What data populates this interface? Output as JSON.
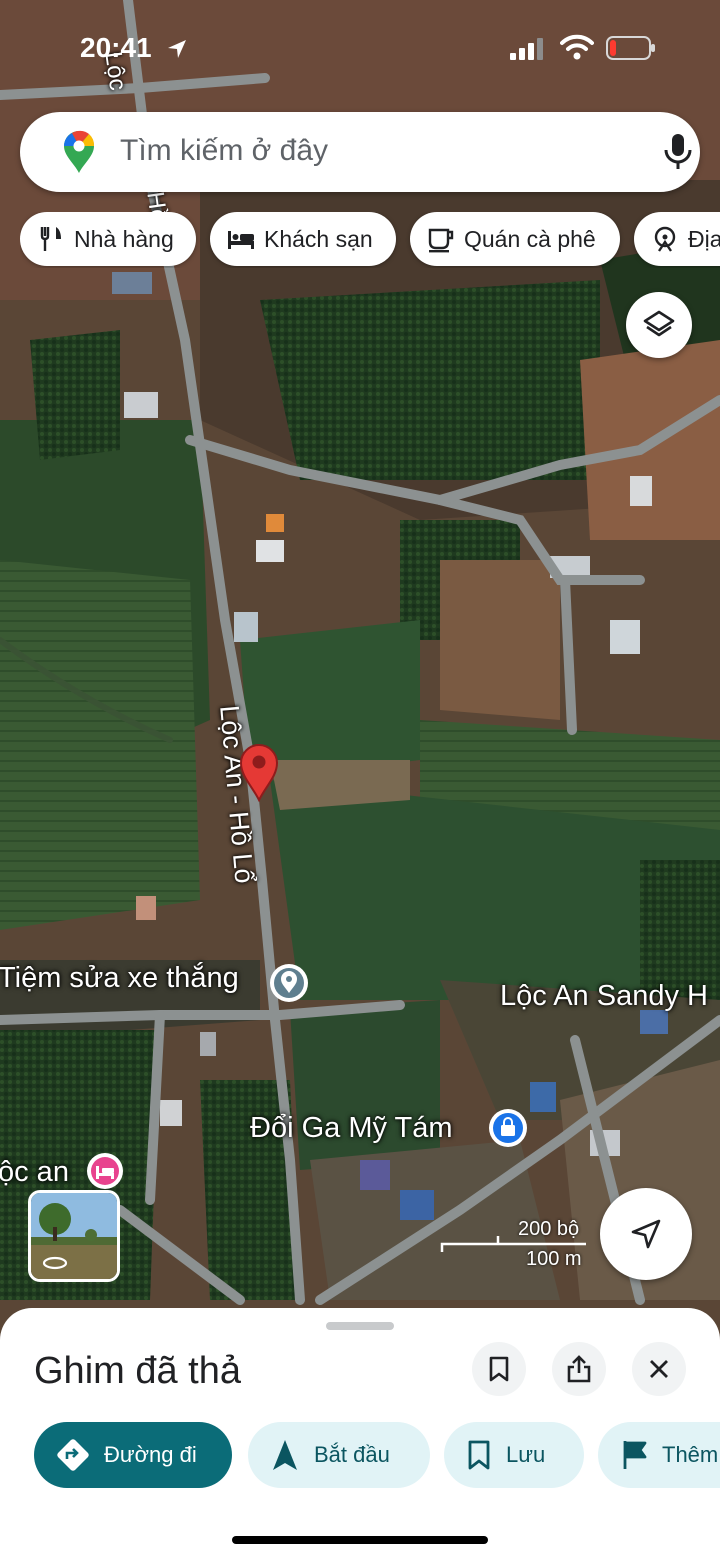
{
  "status_bar": {
    "time": "20:41"
  },
  "search": {
    "placeholder": "Tìm kiếm ở đây"
  },
  "chips": [
    {
      "label": "Nhà hàng",
      "icon": "restaurant-icon"
    },
    {
      "label": "Khách sạn",
      "icon": "hotel-icon"
    },
    {
      "label": "Quán cà phê",
      "icon": "coffee-icon"
    },
    {
      "label": "Địa",
      "icon": "attractions-icon"
    }
  ],
  "map": {
    "road_labels": [
      "Lộc",
      "Hồ Lổ",
      "Lộc An - Hồ Lổ"
    ],
    "places": [
      {
        "name": "Tiệm sửa xe thắng",
        "icon": "place-marker-icon"
      },
      {
        "name": "Lộc An Sandy H"
      },
      {
        "name": "Đổi Ga Mỹ Tám",
        "icon": "shopping-bag-icon"
      },
      {
        "name": "ộc an",
        "icon": "hotel-icon"
      }
    ],
    "scale": {
      "imperial": "200 bộ",
      "metric": "100 m"
    },
    "colors": {
      "pin": "#e53935",
      "place_icon": "#1a73e8",
      "hotel_icon": "#e8438e"
    }
  },
  "sheet": {
    "title": "Ghim đã thả",
    "actions": [
      {
        "label": "Đường đi",
        "icon": "directions-icon"
      },
      {
        "label": "Bắt đầu",
        "icon": "navigation-icon"
      },
      {
        "label": "Lưu",
        "icon": "bookmark-icon"
      },
      {
        "label": "Thêm",
        "icon": "flag-icon"
      }
    ],
    "colors": {
      "primary": "#0b6c78",
      "secondary_bg": "#e1f3f6"
    }
  }
}
